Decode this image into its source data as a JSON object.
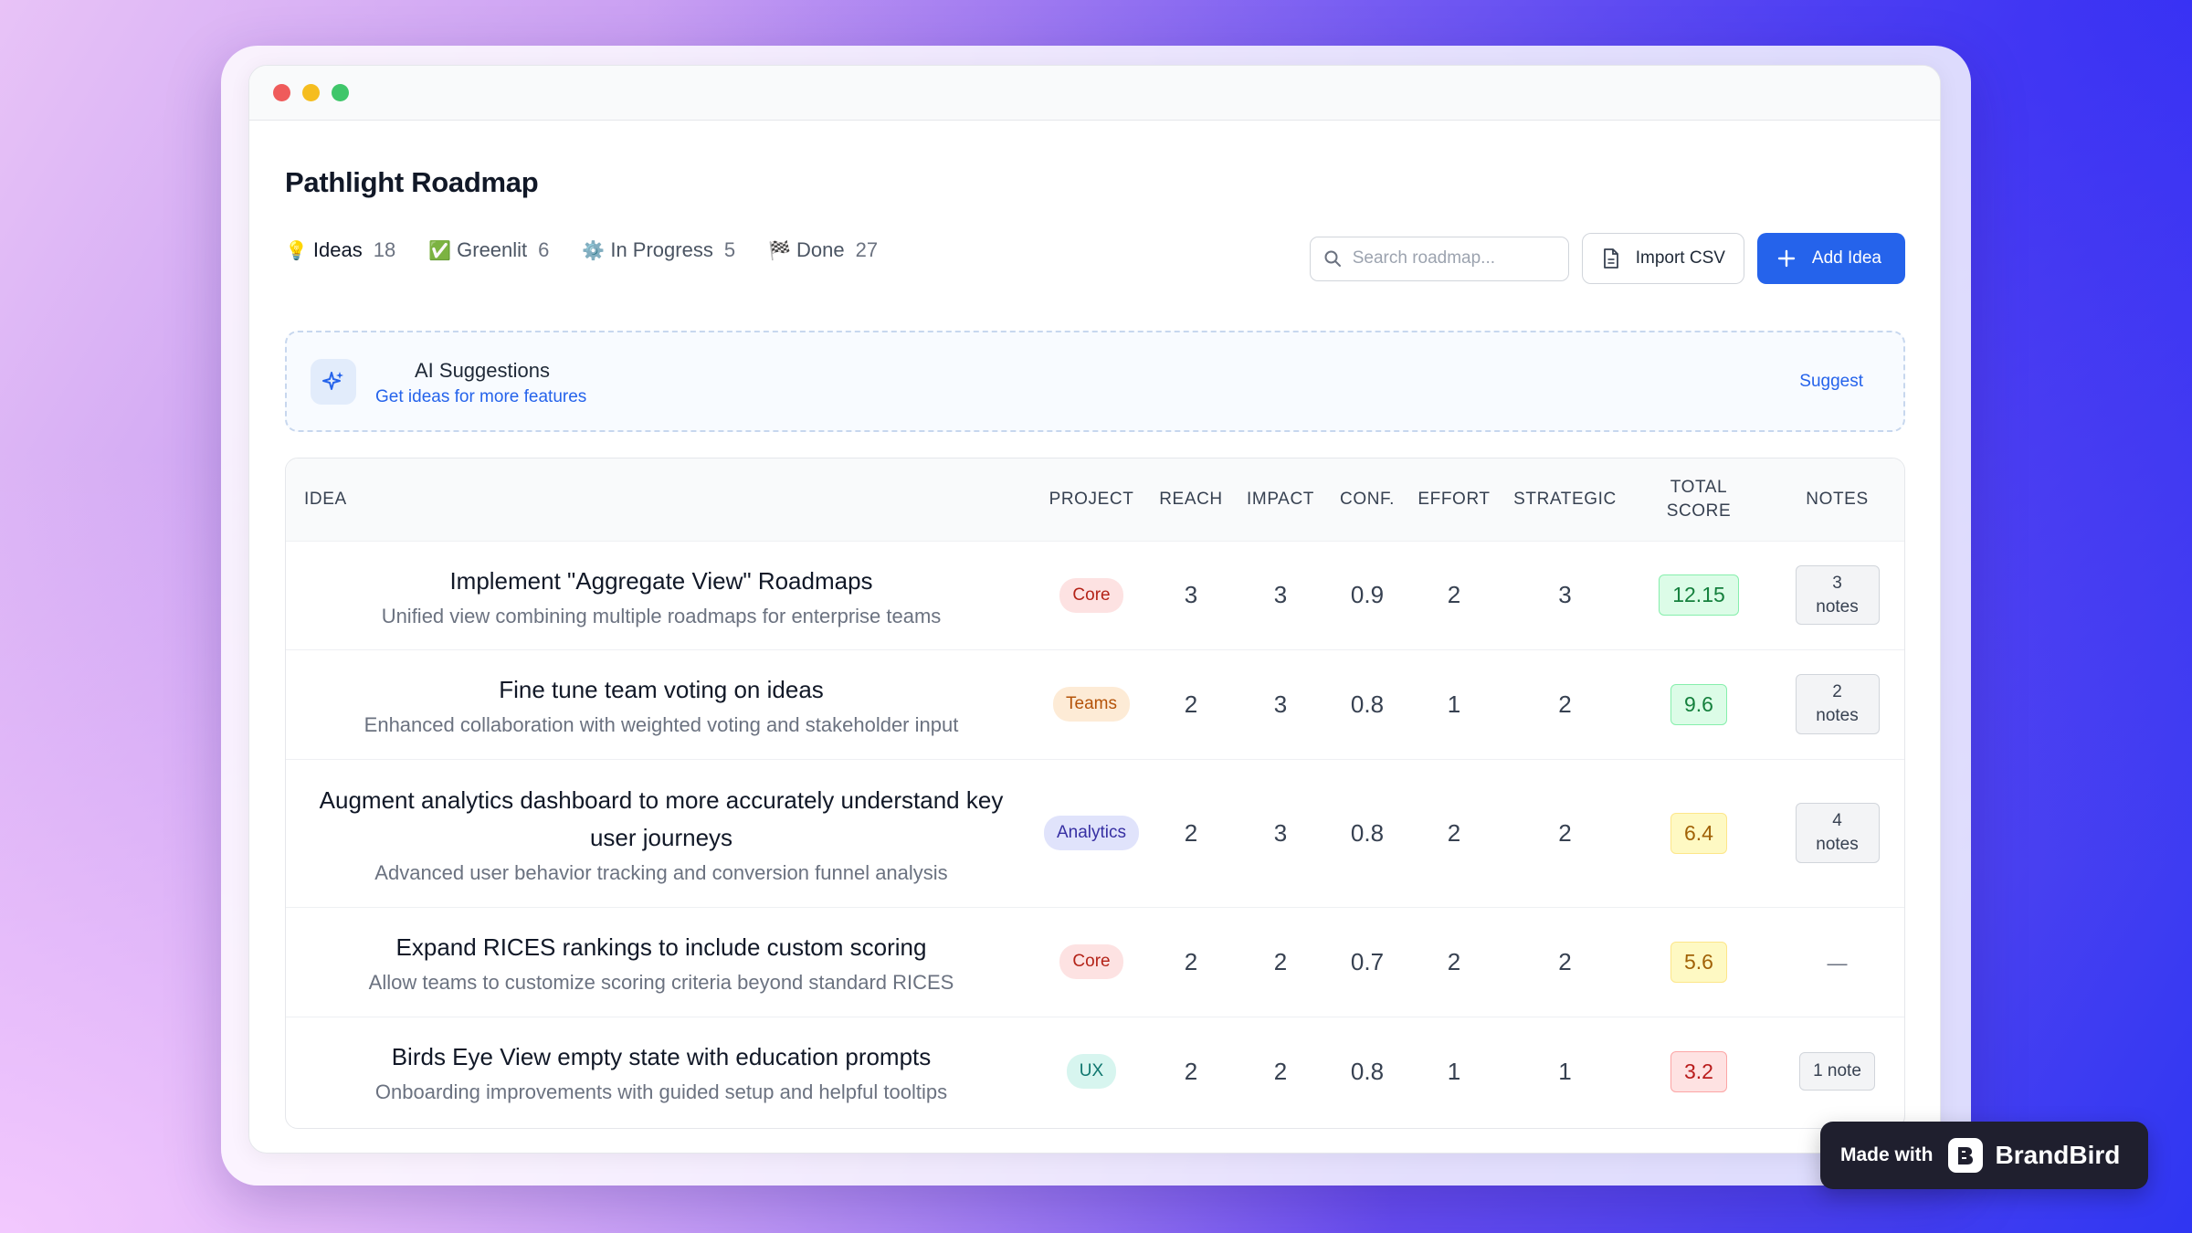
{
  "app": {
    "title": "Pathlight Roadmap"
  },
  "stats": [
    {
      "emoji": "💡",
      "label": "Ideas",
      "count": "18"
    },
    {
      "emoji": "✅",
      "label": "Greenlit",
      "count": "6"
    },
    {
      "emoji": "⚙️",
      "label": "In Progress",
      "count": "5"
    },
    {
      "emoji": "🏁",
      "label": "Done",
      "count": "27"
    }
  ],
  "toolbar": {
    "search_placeholder": "Search roadmap...",
    "import_label": "Import CSV",
    "add_label": "Add Idea"
  },
  "ai": {
    "title": "AI Suggestions",
    "subtitle": "Get ideas for more features",
    "action": "Suggest"
  },
  "table": {
    "headers": {
      "idea": "IDEA",
      "project": "PROJECT",
      "reach": "REACH",
      "impact": "IMPACT",
      "conf": "CONF.",
      "effort": "EFFORT",
      "strategic": "STRATEGIC",
      "total_1": "TOTAL",
      "total_2": "SCORE",
      "notes": "NOTES"
    },
    "rows": [
      {
        "title": "Implement \"Aggregate View\" Roadmaps",
        "title2": "",
        "desc": "Unified view combining multiple roadmaps for enterprise teams",
        "project": "Core",
        "reach": "3",
        "impact": "3",
        "conf": "0.9",
        "effort": "2",
        "strategic": "3",
        "score": "12.15",
        "notes_1": "3",
        "notes_2": "notes"
      },
      {
        "title": "Fine tune team voting on ideas",
        "title2": "",
        "desc": "Enhanced collaboration with weighted voting and stakeholder input",
        "project": "Teams",
        "reach": "2",
        "impact": "3",
        "conf": "0.8",
        "effort": "1",
        "strategic": "2",
        "score": "9.6",
        "notes_1": "2",
        "notes_2": "notes"
      },
      {
        "title": "Augment analytics dashboard to more accurately understand key",
        "title2": "user journeys",
        "desc": "Advanced user behavior tracking and conversion funnel analysis",
        "project": "Analytics",
        "reach": "2",
        "impact": "3",
        "conf": "0.8",
        "effort": "2",
        "strategic": "2",
        "score": "6.4",
        "notes_1": "4",
        "notes_2": "notes"
      },
      {
        "title": "Expand RICES rankings to include custom scoring",
        "title2": "",
        "desc": "Allow teams to customize scoring criteria beyond standard RICES",
        "project": "Core",
        "reach": "2",
        "impact": "2",
        "conf": "0.7",
        "effort": "2",
        "strategic": "2",
        "score": "5.6",
        "notes_empty": "—"
      },
      {
        "title": "Birds Eye View empty state with education prompts",
        "title2": "",
        "desc": "Onboarding improvements with guided setup and helpful tooltips",
        "project": "UX",
        "reach": "2",
        "impact": "2",
        "conf": "0.8",
        "effort": "1",
        "strategic": "1",
        "score": "3.2",
        "notes_single": "1 note"
      }
    ]
  },
  "colors": {
    "accent": "#2563eb",
    "badge_core_bg": "#fde2e2",
    "badge_core_fg": "#b42318",
    "badge_teams_bg": "#fdebd6",
    "badge_teams_fg": "#b45309",
    "badge_analytics_bg": "#e0e3fb",
    "badge_analytics_fg": "#3730a3",
    "badge_ux_bg": "#d7f5ef",
    "badge_ux_fg": "#0f766e",
    "score_green_bg": "#dcfce7",
    "score_green_fg": "#15803d",
    "score_yellow_bg": "#fef9c3",
    "score_yellow_fg": "#a16207",
    "score_red_bg": "#fee2e2",
    "score_red_fg": "#b91c1c"
  },
  "watermark": {
    "made_with": "Made with",
    "brand": "BrandBird"
  }
}
